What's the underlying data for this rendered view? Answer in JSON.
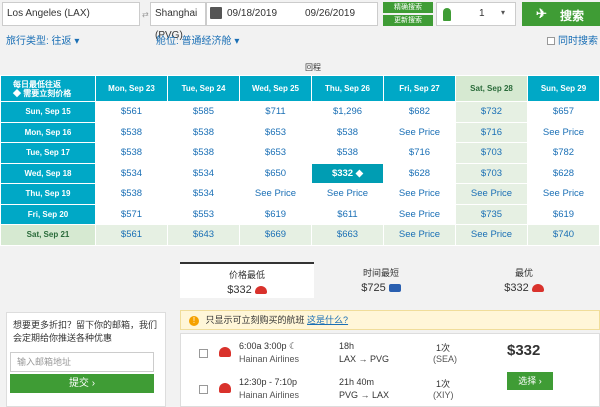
{
  "search": {
    "origin": "Los Angeles (LAX)",
    "swap_glyph": "⇄",
    "destination": "Shanghai (PVG)",
    "depart_date": "09/18/2019",
    "return_date": "09/26/2019",
    "fare_compare_label": "精确搜索",
    "refresh_label": "更新搜索",
    "passengers": "1",
    "caret": "▾",
    "search_label": "搜索",
    "plane_glyph": "✈"
  },
  "filters": {
    "trip_type": "旅行类型: 往返 ▾",
    "cabin": "舱位: 普通经济舱 ▾",
    "flexible": "同时搜索"
  },
  "grid": {
    "return_label": "回程",
    "corner_line1": "每日最低往返",
    "corner_line2": "◆ 需要立刻价格",
    "return_dates": [
      "Mon, Sep 23",
      "Tue, Sep 24",
      "Wed, Sep 25",
      "Thu, Sep 26",
      "Fri, Sep 27",
      "Sat, Sep 28",
      "Sun, Sep 29"
    ],
    "rows": [
      {
        "depart": "Sun, Sep 15",
        "prices": [
          "$561",
          "$585",
          "$711",
          "$1,296",
          "$682",
          "$732",
          "$657"
        ]
      },
      {
        "depart": "Mon, Sep 16",
        "prices": [
          "$538",
          "$538",
          "$653",
          "$538",
          "See Price",
          "$716",
          "See Price"
        ]
      },
      {
        "depart": "Tue, Sep 17",
        "prices": [
          "$538",
          "$538",
          "$653",
          "$538",
          "$716",
          "$703",
          "$782"
        ]
      },
      {
        "depart": "Wed, Sep 18",
        "prices": [
          "$534",
          "$534",
          "$650",
          "$332 ◆",
          "$628",
          "$703",
          "$628"
        ]
      },
      {
        "depart": "Thu, Sep 19",
        "prices": [
          "$538",
          "$534",
          "See Price",
          "See Price",
          "See Price",
          "See Price",
          "See Price"
        ]
      },
      {
        "depart": "Fri, Sep 20",
        "prices": [
          "$571",
          "$553",
          "$619",
          "$611",
          "See Price",
          "$735",
          "$619"
        ]
      },
      {
        "depart": "Sat, Sep 21",
        "prices": [
          "$561",
          "$643",
          "$669",
          "$663",
          "See Price",
          "See Price",
          "$740"
        ]
      }
    ]
  },
  "tabs": [
    {
      "title": "价格最低",
      "price": "$332"
    },
    {
      "title": "时间最短",
      "price": "$725"
    },
    {
      "title": "最优",
      "price": "$332"
    }
  ],
  "promo": {
    "text": "想要更多折扣？留下你的邮箱，我们会定期给你推送各种优惠",
    "input_placeholder": "输入邮箱地址",
    "submit_label": "提交 ›"
  },
  "notice": {
    "icon": "!",
    "text": "只显示可立刻购买的航班",
    "link": "这是什么?"
  },
  "result": {
    "legs": [
      {
        "times": "6:00a  3:00p ☾",
        "airline": "Hainan Airlines",
        "duration": "18h",
        "route": "LAX → PVG",
        "stops": "1次",
        "via": "(SEA)"
      },
      {
        "times": "12:30p - 7:10p",
        "airline": "Hainan Airlines",
        "duration": "21h 40m",
        "route": "PVG → LAX",
        "stops": "1次",
        "via": "(XIY)"
      }
    ],
    "price": "$332",
    "choose_label": "选择 ›"
  },
  "colors": {
    "grid_header": "#00a8c6",
    "accent_green": "#3f9c35",
    "link_blue": "#1a6fb5"
  }
}
